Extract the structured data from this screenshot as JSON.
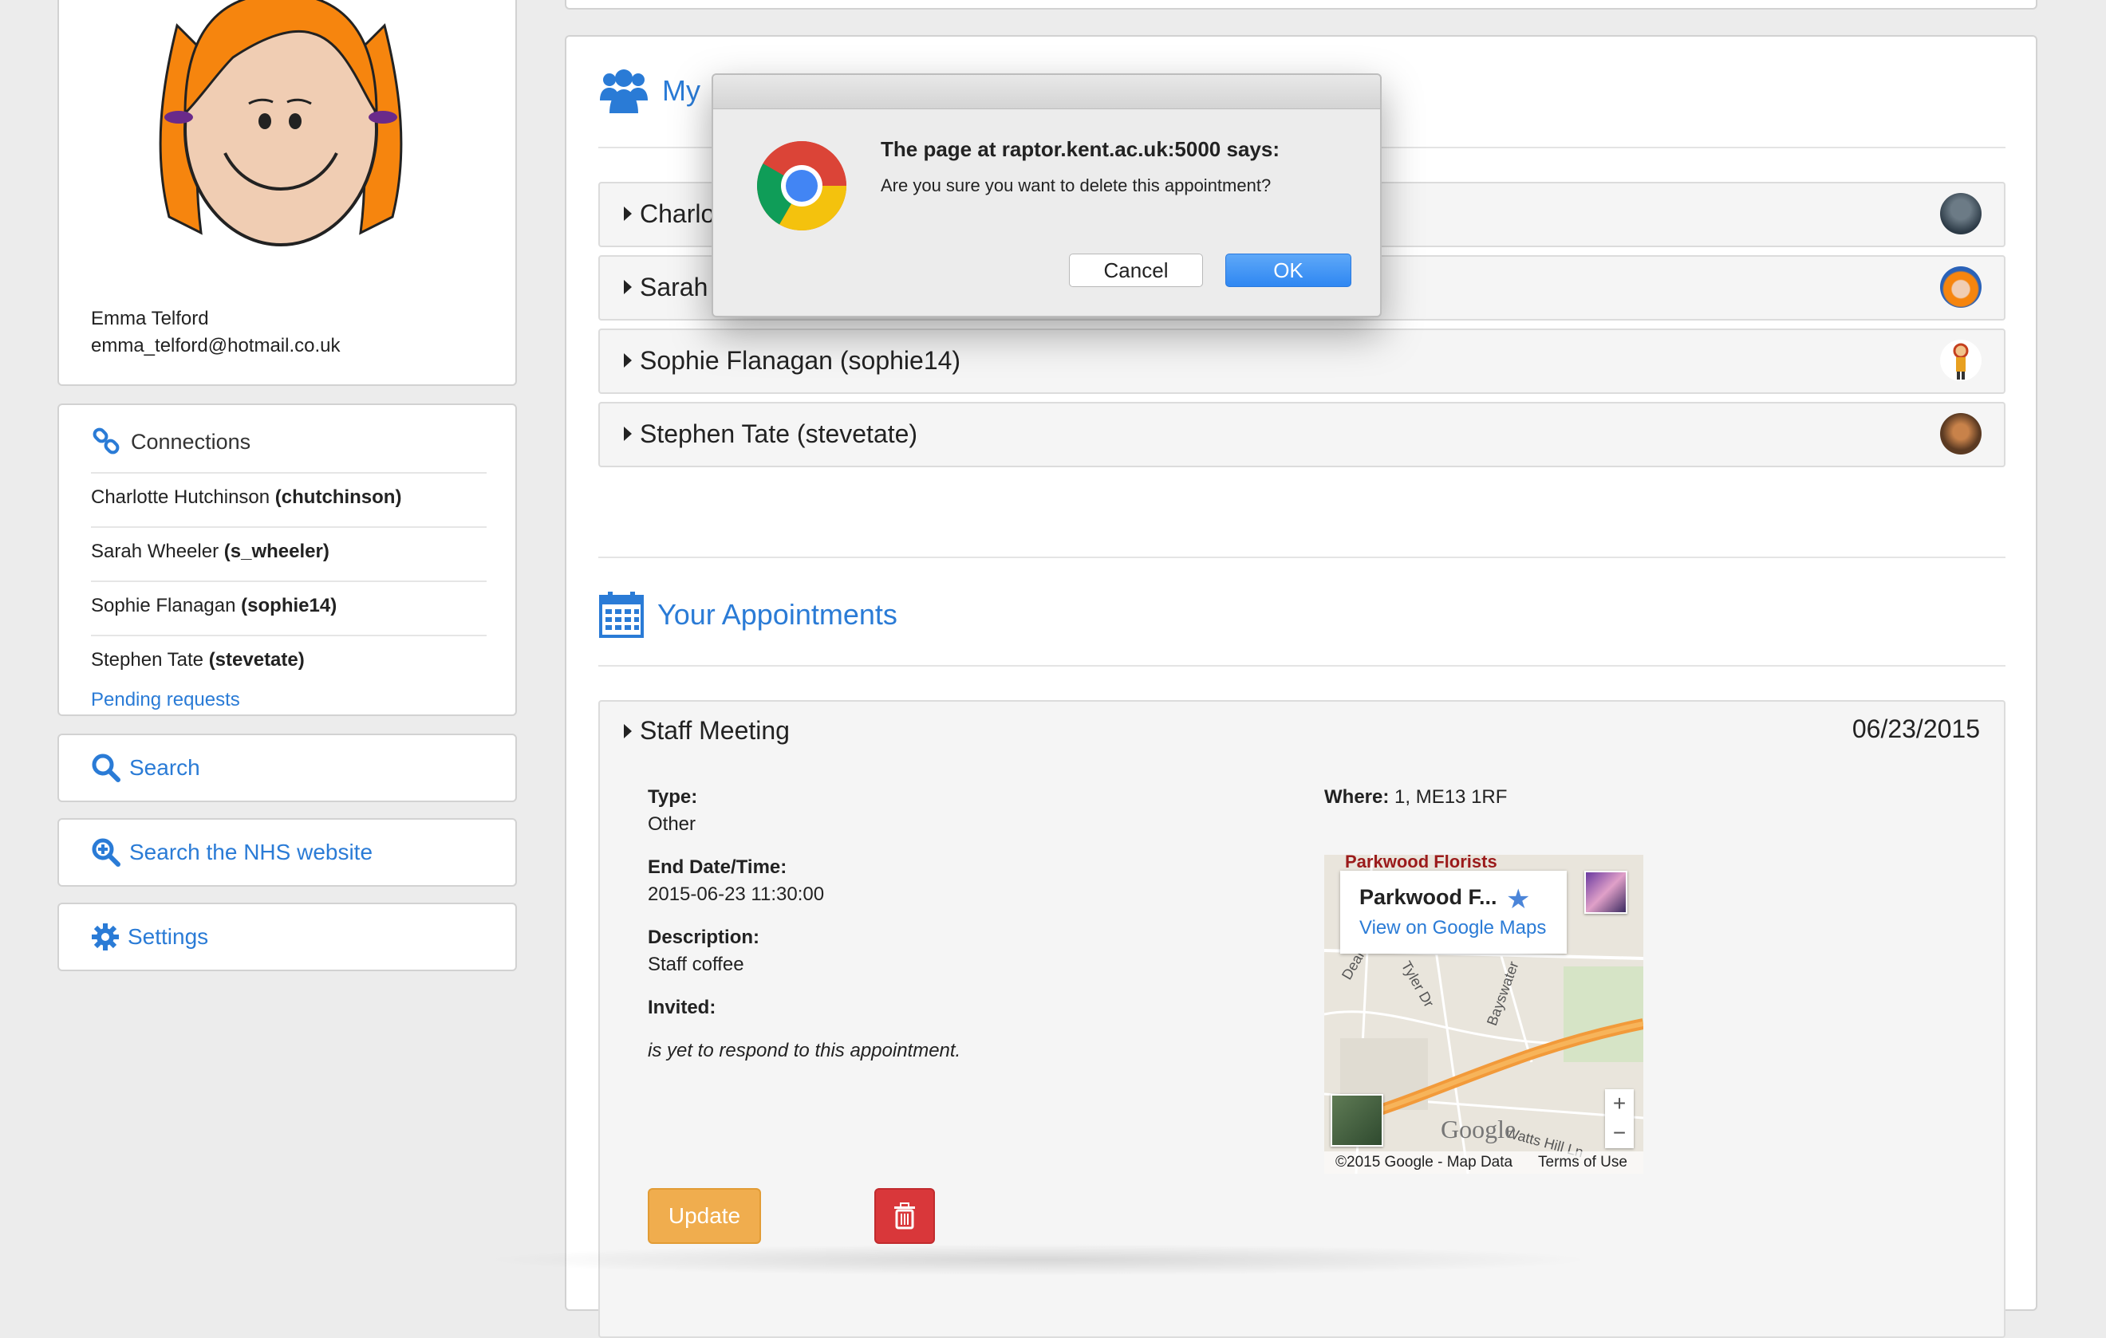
{
  "profile": {
    "name": "Emma Telford",
    "email": "emma_telford@hotmail.co.uk"
  },
  "connections": {
    "heading": "Connections",
    "items": [
      {
        "name": "Charlotte Hutchinson",
        "username": "(chutchinson)"
      },
      {
        "name": "Sarah Wheeler",
        "username": "(s_wheeler)"
      },
      {
        "name": "Sophie Flanagan",
        "username": "(sophie14)"
      },
      {
        "name": "Stephen Tate",
        "username": "(stevetate)"
      }
    ],
    "pending": "Pending requests"
  },
  "sidebar": {
    "search": "Search",
    "nhs": "Search the NHS website",
    "settings": "Settings"
  },
  "my_connections": {
    "title": "My",
    "rows": [
      "Charlo",
      "Sarah",
      "Sophie Flanagan (sophie14)",
      "Stephen Tate (stevetate)"
    ]
  },
  "appointments": {
    "title": "Your Appointments",
    "item": {
      "title": "Staff Meeting",
      "date": "06/23/2015",
      "type_label": "Type:",
      "type_value": "Other",
      "end_label": "End Date/Time:",
      "end_value": "2015-06-23 11:30:00",
      "desc_label": "Description:",
      "desc_value": "Staff coffee",
      "invited_label": "Invited:",
      "invited_note": "is yet to respond to this appointment.",
      "where_label": "Where:",
      "where_value": "1, ME13 1RF",
      "update": "Update"
    },
    "map": {
      "place_name": "Parkwood F...",
      "view_link": "View on Google Maps",
      "top_label": "Parkwood Florists",
      "streets": [
        "Deanwoo",
        "Tyler Dr",
        "Bayswater",
        "Watts Hill Ln"
      ],
      "google": "Google",
      "copyright": "©2015 Google - Map Data",
      "terms": "Terms of Use",
      "zoom_in": "+",
      "zoom_out": "−"
    }
  },
  "dialog": {
    "title": "The page at raptor.kent.ac.uk:5000 says:",
    "message": "Are you sure you want to delete this appointment?",
    "cancel": "Cancel",
    "ok": "OK"
  },
  "colors": {
    "accent": "#2a7bd6",
    "update": "#f0ad4e",
    "delete": "#d9373a",
    "ok": "#2f87f2"
  }
}
